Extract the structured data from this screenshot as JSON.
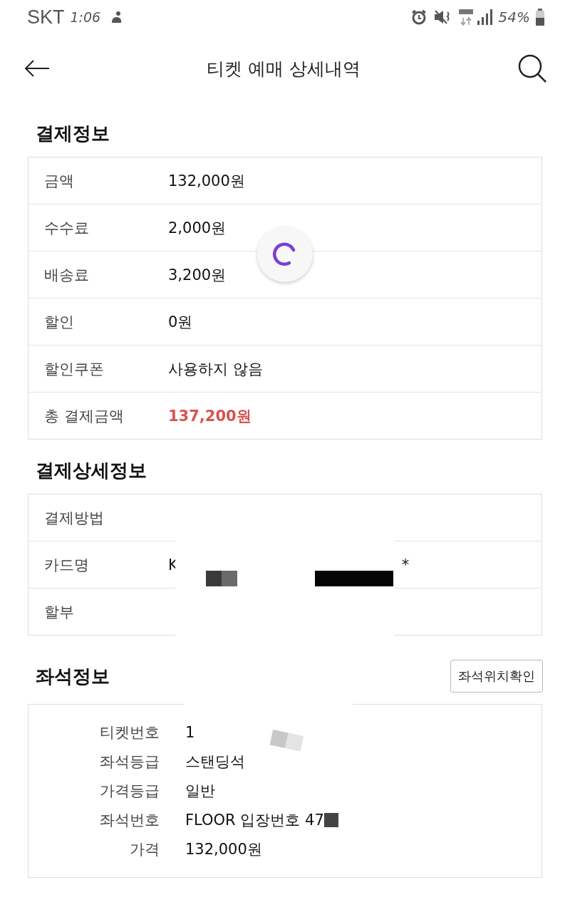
{
  "status_bar": {
    "carrier": "SKT",
    "time": "1:06",
    "battery": "54%"
  },
  "header": {
    "title": "티켓 예매 상세내역"
  },
  "loading": true,
  "payment": {
    "title": "결제정보",
    "rows": [
      {
        "label": "금액",
        "value": "132,000원",
        "kind": "normal"
      },
      {
        "label": "수수료",
        "value": "2,000원",
        "kind": "normal"
      },
      {
        "label": "배송료",
        "value": "3,200원",
        "kind": "normal"
      },
      {
        "label": "할인",
        "value": "0원",
        "kind": "normal"
      },
      {
        "label": "할인쿠폰",
        "value": "사용하지 않음",
        "kind": "normal"
      },
      {
        "label": "총 결제금액",
        "value": "137,200원",
        "kind": "total"
      }
    ]
  },
  "payment_details": {
    "title": "결제상세정보",
    "rows": [
      {
        "label": "결제방법"
      },
      {
        "label": "카드명",
        "value": "K",
        "tail": "*"
      },
      {
        "label": "할부"
      }
    ]
  },
  "seat": {
    "title": "좌석정보",
    "button": "좌석위치확인",
    "rows": [
      {
        "label": "티켓번호",
        "value": "1"
      },
      {
        "label": "좌석등급",
        "value": "스탠딩석"
      },
      {
        "label": "가격등급",
        "value": "일반"
      },
      {
        "label": "좌석번호",
        "value": "FLOOR 입장번호 47",
        "masked": true
      },
      {
        "label": "가격",
        "value": "132,000원"
      }
    ]
  }
}
